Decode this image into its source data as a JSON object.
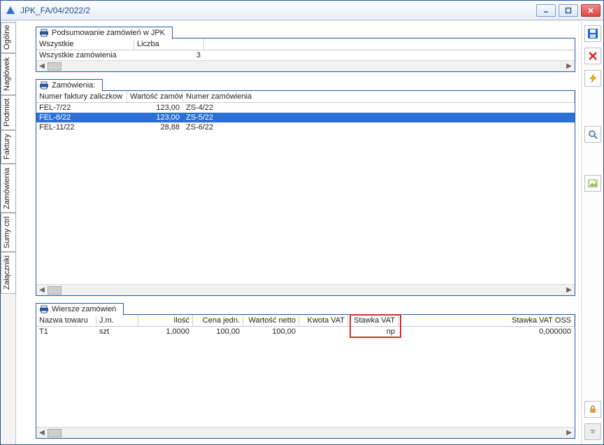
{
  "window": {
    "title": "JPK_FA/04/2022/2"
  },
  "vtabs": [
    {
      "id": "ogolne",
      "label": "Ogólne"
    },
    {
      "id": "naglowek",
      "label": "Nagłówek"
    },
    {
      "id": "podmiot",
      "label": "Podmiot"
    },
    {
      "id": "faktury",
      "label": "Faktury"
    },
    {
      "id": "zamowienia",
      "label": "Zamówienia"
    },
    {
      "id": "sumy",
      "label": "Sumy ctrl"
    },
    {
      "id": "zalaczniki",
      "label": "Załączniki"
    }
  ],
  "active_vtab": "zamowienia",
  "summary": {
    "tab_label": "Podsumowanie zamówień w JPK",
    "headers": [
      "Wszystkie",
      "Liczba"
    ],
    "rows": [
      {
        "label": "Wszystkie zamówienia",
        "count": "3"
      }
    ]
  },
  "orders": {
    "tab_label": "Zamówienia:",
    "headers": [
      "Numer faktury zaliczkow",
      "Wartość zamów",
      "Numer zamówienia"
    ],
    "rows": [
      {
        "nfz": "FEL-7/22",
        "wz": "123,00",
        "nz": "ZS-4/22",
        "selected": false
      },
      {
        "nfz": "FEL-8/22",
        "wz": "123,00",
        "nz": "ZS-5/22",
        "selected": true
      },
      {
        "nfz": "FEL-11/22",
        "wz": "28,88",
        "nz": "ZS-6/22",
        "selected": false
      }
    ]
  },
  "lines": {
    "tab_label": "Wiersze zamówień",
    "headers": [
      "Nazwa towaru",
      "J.m.",
      "Ilość",
      "Cena jedn.",
      "Wartość netto",
      "Kwota VAT",
      "Stawka VAT",
      "Stawka VAT OSS"
    ],
    "rows": [
      {
        "nazwa": "T1",
        "jm": "szt",
        "ilosc": "1,0000",
        "cena": "100,00",
        "netto": "100,00",
        "kwota": "",
        "stawka": "np",
        "oss": "0,000000"
      }
    ]
  }
}
